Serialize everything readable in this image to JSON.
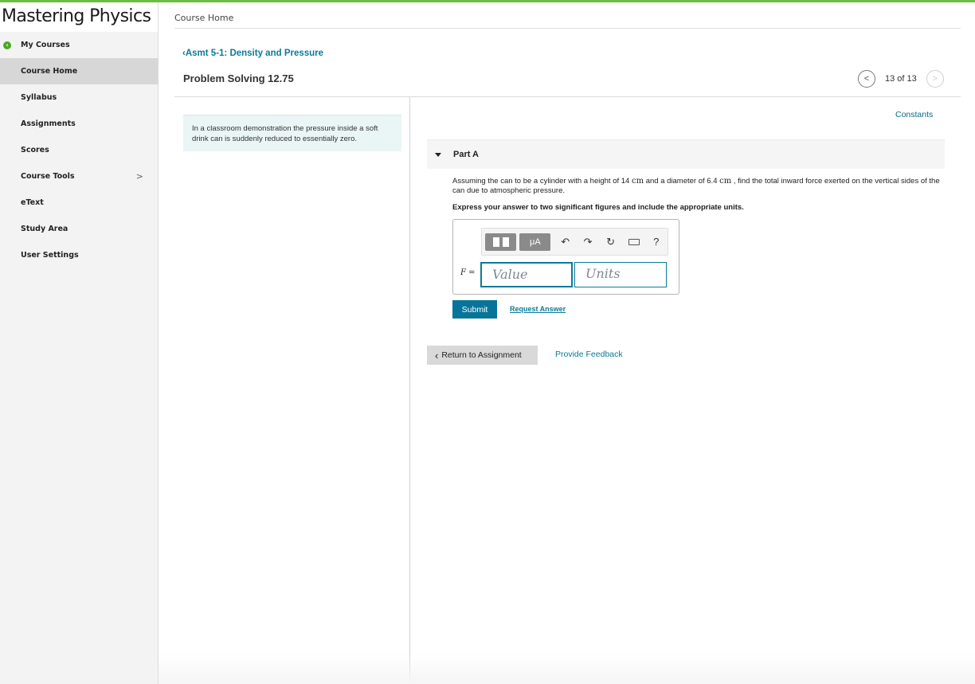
{
  "brand": {
    "title": "Mastering Physics"
  },
  "sidebar": {
    "items": [
      {
        "label": "My Courses"
      },
      {
        "label": "Course Home"
      },
      {
        "label": "Syllabus"
      },
      {
        "label": "Assignments"
      },
      {
        "label": "Scores"
      },
      {
        "label": "Course Tools"
      },
      {
        "label": "eText"
      },
      {
        "label": "Study Area"
      },
      {
        "label": "User Settings"
      }
    ],
    "active": "Course Home"
  },
  "header": {
    "breadcrumb": "Course Home",
    "assignment_link": "Asmt 5-1: Density and Pressure",
    "problem_title": "Problem Solving 12.75",
    "pager": "13 of 13"
  },
  "intro": {
    "text": "In a classroom demonstration the pressure inside a soft drink can is suddenly reduced to essentially zero."
  },
  "constants_link": "Constants",
  "part": {
    "label": "Part A",
    "question_a": "Assuming the can to be a cylinder with a height of 14 ",
    "unit_cm_1": "cm",
    "question_b": " and a diameter of 6.4 ",
    "unit_cm_2": "cm",
    "question_c": " , find the total inward force exerted on the vertical sides of the can due to atmospheric pressure.",
    "instruction": "Express your answer to two significant figures and include the appropriate units."
  },
  "answer": {
    "variable": "F",
    "equals": " =",
    "value_placeholder": "Value",
    "units_placeholder": "Units",
    "toolbar_mu": "μA",
    "toolbar_help": "?"
  },
  "actions": {
    "submit": "Submit",
    "request_answer": "Request Answer",
    "return": "Return to Assignment",
    "feedback": "Provide Feedback"
  },
  "colors": {
    "accent": "#6abf40",
    "link": "#0a7a9b",
    "submit": "#07759a"
  },
  "icons": [
    "back-icon",
    "chevron-right-icon",
    "chevron-left-icon",
    "undo-icon",
    "redo-icon",
    "reset-icon",
    "keyboard-icon",
    "help-icon",
    "triangle-down-icon"
  ]
}
